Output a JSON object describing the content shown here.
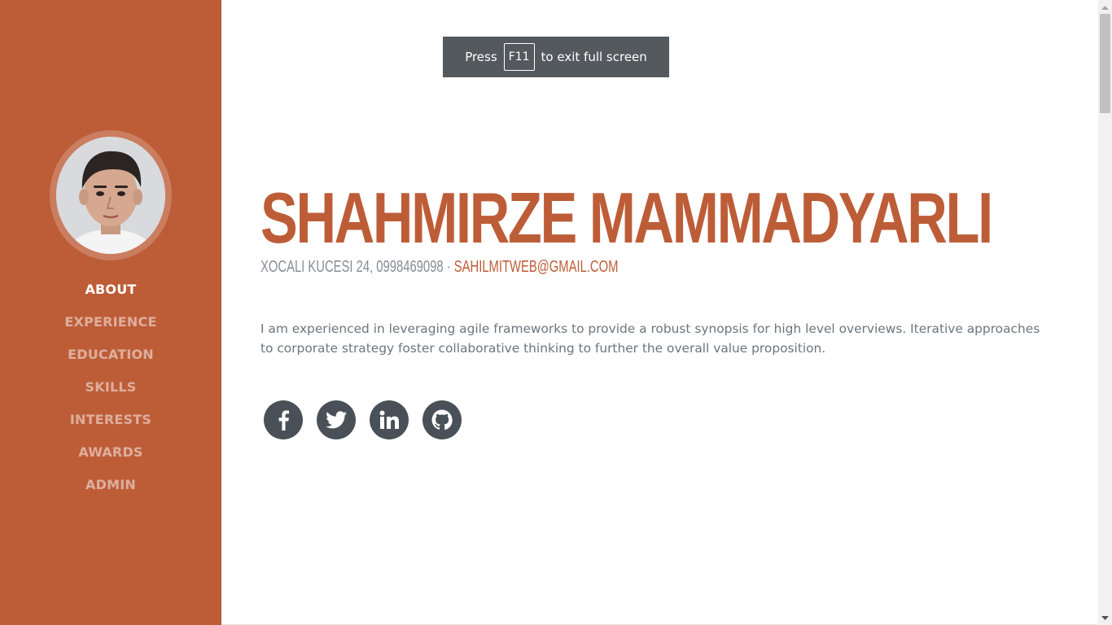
{
  "colors": {
    "primary": "#bd5d38",
    "sidebar_bg": "#bd5d38",
    "social_bg": "#495057",
    "text_muted": "#868e96",
    "toast_bg": "#54595e"
  },
  "fullscreen_toast": {
    "press": "Press",
    "key": "F11",
    "suffix": "to exit full screen"
  },
  "sidebar": {
    "avatar_icon": "profile-photo",
    "nav": [
      {
        "label": "ABOUT",
        "active": true
      },
      {
        "label": "EXPERIENCE",
        "active": false
      },
      {
        "label": "EDUCATION",
        "active": false
      },
      {
        "label": "SKILLS",
        "active": false
      },
      {
        "label": "INTERESTS",
        "active": false
      },
      {
        "label": "AWARDS",
        "active": false
      },
      {
        "label": "ADMIN",
        "active": false
      }
    ]
  },
  "about": {
    "name": "SHAHMIRZE MAMMADYARLI",
    "address": "XOCALI KUCESI 24, 0998469098 · ",
    "email": "SAHILMITWEB@GMAIL.COM",
    "lead": "I am experienced in leveraging agile frameworks to provide a robust synopsis for high level overviews. Iterative approaches to corporate strategy foster collaborative thinking to further the overall value proposition."
  },
  "social": [
    {
      "icon": "facebook-icon"
    },
    {
      "icon": "twitter-icon"
    },
    {
      "icon": "linkedin-icon"
    },
    {
      "icon": "github-icon"
    }
  ]
}
